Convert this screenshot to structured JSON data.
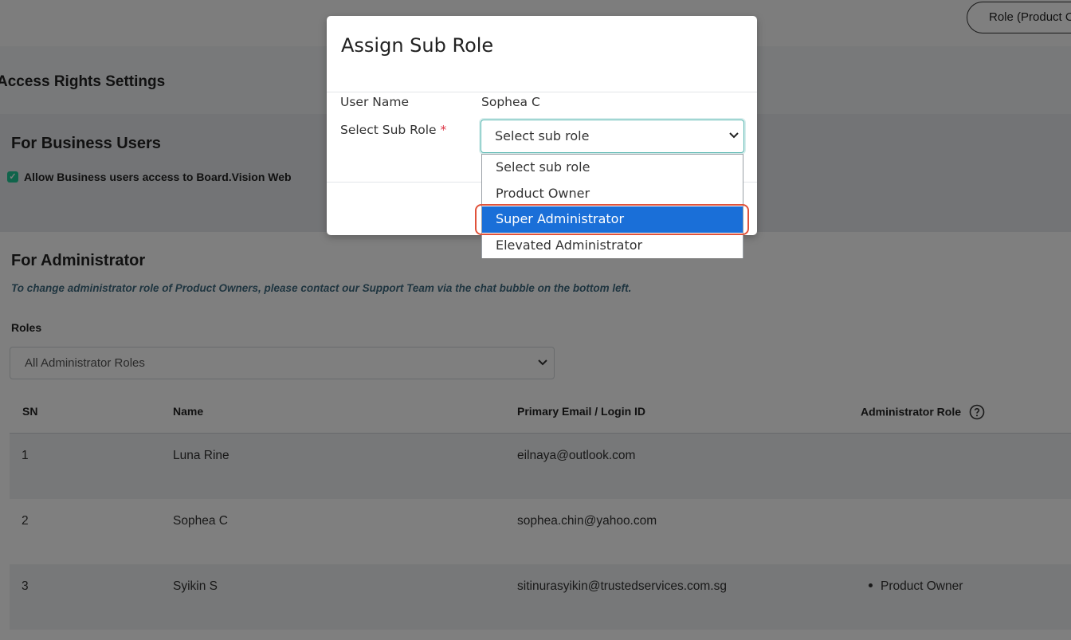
{
  "header": {
    "role_button_label": "Role (Product Owner)"
  },
  "page": {
    "title": "Access Rights Settings",
    "business_section": {
      "title": "For Business Users",
      "allow_label": "Allow Business users access to Board.Vision Web"
    },
    "admin_section": {
      "title": "For Administrator",
      "note": "To change administrator role of Product Owners, please contact our Support Team via the chat bubble on the bottom left.",
      "roles_label": "Roles",
      "roles_select_value": "All Administrator Roles"
    },
    "table": {
      "headers": [
        "SN",
        "Name",
        "Primary Email / Login ID",
        "Administrator Role"
      ],
      "rows": [
        {
          "sn": "1",
          "name": "Luna Rine",
          "email": "eilnaya@outlook.com",
          "role": ""
        },
        {
          "sn": "2",
          "name": "Sophea C",
          "email": "sophea.chin@yahoo.com",
          "role": ""
        },
        {
          "sn": "3",
          "name": "Syikin S",
          "email": "sitinurasyikin@trustedservices.com.sg",
          "role": "Product Owner"
        }
      ]
    }
  },
  "modal": {
    "title": "Assign Sub Role",
    "user_name_label": "User Name",
    "user_name_value": "Sophea C",
    "sub_role_label": "Select Sub Role",
    "required_mark": "*",
    "sub_role_value": "Select sub role",
    "options": [
      "Select sub role",
      "Product Owner",
      "Super Administrator",
      "Elevated Administrator"
    ],
    "highlighted_option": "Super Administrator"
  },
  "colors": {
    "accent": "#5cb8b2",
    "selected_option": "#1a6fd8",
    "highlight_outline": "#e0523a",
    "note_text": "#3e6a80",
    "checkbox": "#20c997"
  },
  "icons": {
    "checkbox": "check-icon",
    "help": "question-circle-icon",
    "select": "chevron-down-icon"
  }
}
